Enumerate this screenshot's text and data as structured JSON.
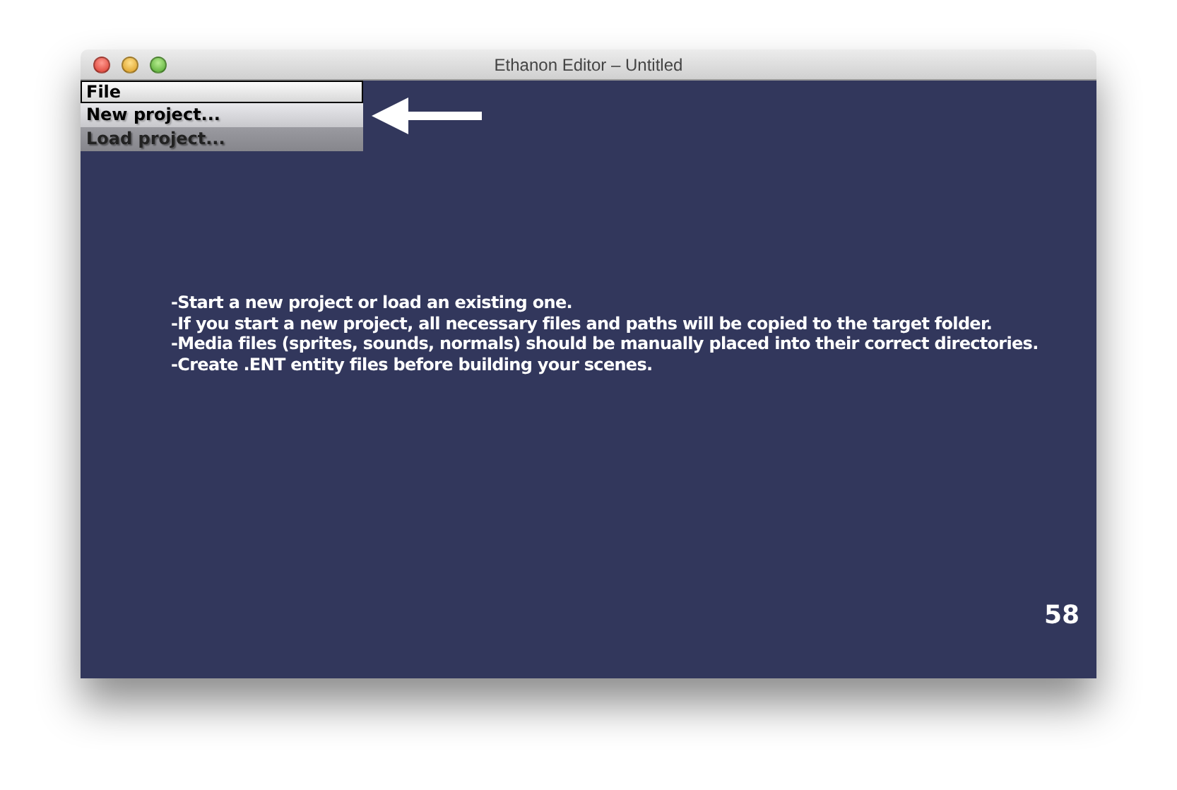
{
  "window": {
    "title": "Ethanon Editor – Untitled"
  },
  "menu": {
    "title": "File",
    "items": [
      {
        "label": "New project...",
        "selected": true
      },
      {
        "label": "Load project...",
        "selected": false
      }
    ]
  },
  "instructions": [
    "-Start a new project or load an existing one.",
    "-If you start a new project, all necessary files and paths will be copied to the target folder.",
    "-Media files (sprites, sounds, normals) should be manually placed into their correct directories.",
    "-Create .ENT entity files before building your scenes."
  ],
  "fps": "58"
}
